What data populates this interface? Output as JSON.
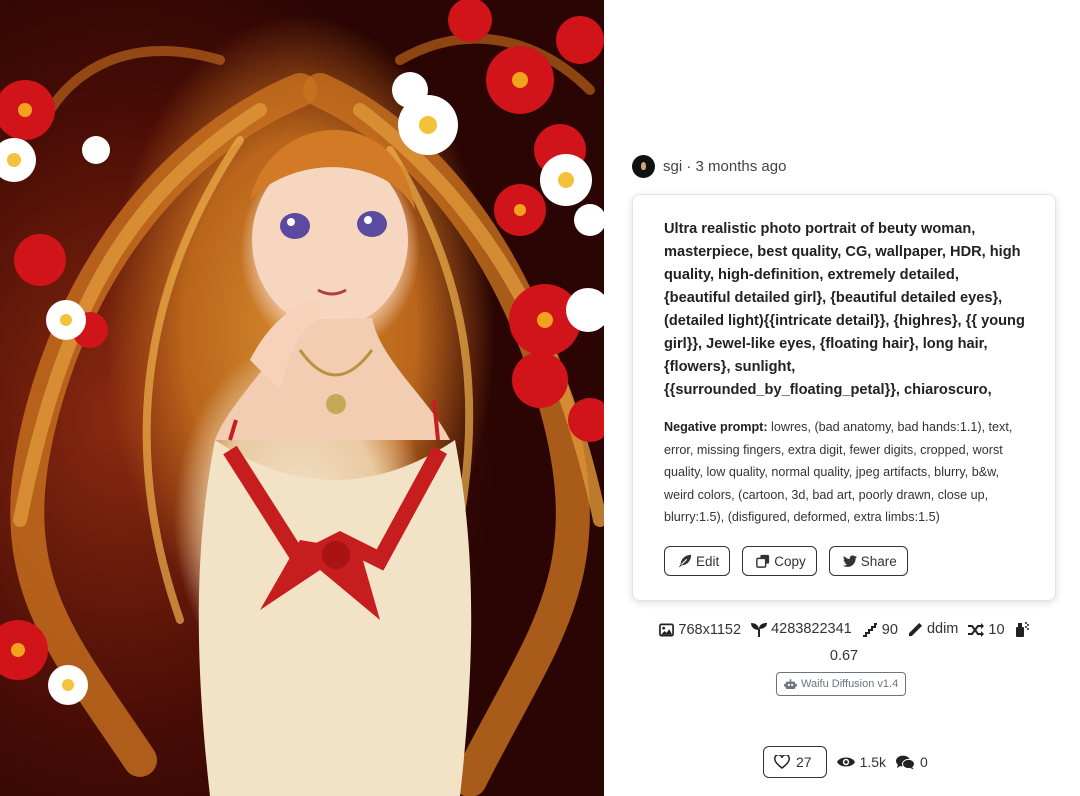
{
  "image": {
    "alt": "Anime illustration of a woman with long orange hair lying among red flowers"
  },
  "post": {
    "author": "sgi",
    "time_ago": "3 months ago",
    "separator": " · "
  },
  "prompt": {
    "text": "Ultra realistic photo portrait of beuty woman, masterpiece, best quality, CG, wallpaper, HDR, high quality, high-definition, extremely detailed, {beautiful detailed girl}, {beautiful detailed eyes}, (detailed light){{intricate detail}}, {highres}, {{ young girl}}, Jewel-like eyes, {floating hair}, long hair, {flowers}, sunlight, {{surrounded_by_floating_petal}}, chiaroscuro,",
    "negative_label": "Negative prompt:",
    "negative_text": " lowres, (bad anatomy, bad hands:1.1), text, error, missing fingers, extra digit, fewer digits, cropped, worst quality, low quality, normal quality, jpeg artifacts, blurry, b&w, weird colors, (cartoon, 3d, bad art, poorly drawn, close up, blurry:1.5), (disfigured, deformed, extra limbs:1.5)"
  },
  "actions": {
    "edit": "Edit",
    "copy": "Copy",
    "share": "Share"
  },
  "meta": {
    "resolution": "768x1152",
    "seed": "4283822341",
    "steps": "90",
    "sampler": "ddim",
    "cfg": "10",
    "strength": "0.67"
  },
  "model": "Waifu Diffusion v1.4",
  "stats": {
    "likes": "27",
    "views": "1.5k",
    "comments": "0"
  },
  "icons": [
    "image-icon",
    "seedling-icon",
    "stairs-icon",
    "eyedropper-icon",
    "shuffle-icon",
    "spray-icon",
    "robot-icon",
    "heart-icon",
    "eye-icon",
    "comments-icon",
    "feather-icon",
    "copy-icon",
    "twitter-icon"
  ]
}
